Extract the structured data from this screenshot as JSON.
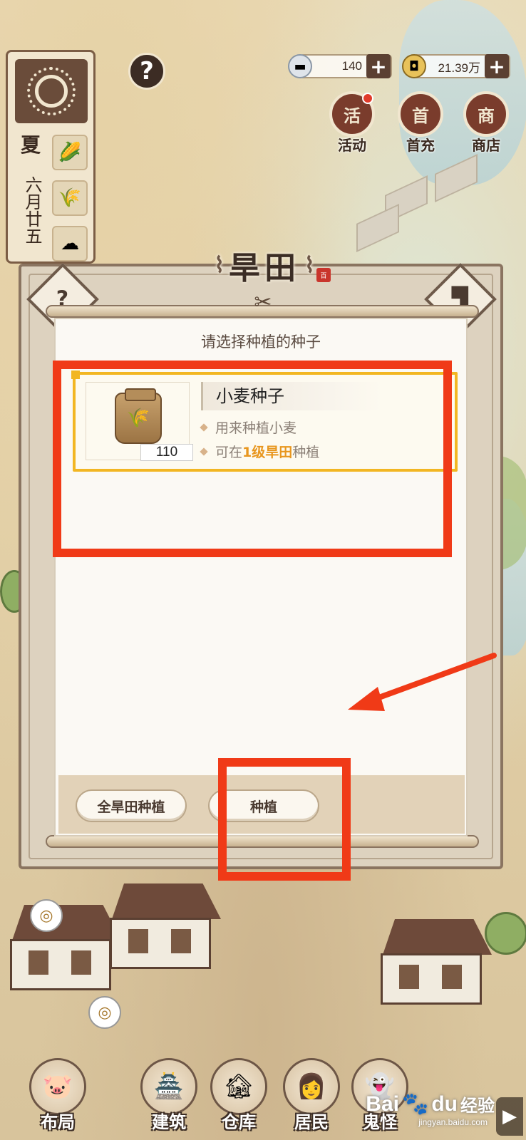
{
  "hud": {
    "season": "夏",
    "date": "六月廿五",
    "help_symbol": "?",
    "currency_silver": "140",
    "currency_coins": "21.39万",
    "plus_symbol": "+"
  },
  "top_buttons": [
    {
      "label": "活动",
      "icon_text": "活",
      "icon": "activity-icon",
      "has_notification": true
    },
    {
      "label": "首充",
      "icon_text": "首",
      "icon": "first-charge-icon",
      "has_notification": false
    },
    {
      "label": "商店",
      "icon_text": "商",
      "icon": "shop-icon",
      "has_notification": false
    }
  ],
  "dialog": {
    "title": "旱田",
    "stamp_text": "百",
    "help_symbol": "?",
    "heading": "请选择种植的种子",
    "seed": {
      "name": "小麦种子",
      "quantity": "110",
      "desc_1": "用来种植小麦",
      "desc_2_prefix": "可在",
      "desc_2_highlight": "1级旱田",
      "desc_2_suffix": "种植"
    },
    "buttons": {
      "plant_all": "全旱田种植",
      "plant": "种植"
    }
  },
  "bottom_nav": [
    {
      "label": "布局",
      "icon": "layout-icon",
      "glyph": "🐷"
    },
    {
      "label": "建筑",
      "icon": "building-icon",
      "glyph": "🏯"
    },
    {
      "label": "仓库",
      "icon": "warehouse-icon",
      "glyph": "🏚"
    },
    {
      "label": "居民",
      "icon": "residents-icon",
      "glyph": "👩"
    },
    {
      "label": "鬼怪",
      "icon": "ghost-icon",
      "glyph": "👻"
    }
  ],
  "watermark": {
    "text_1": "Bai",
    "text_2": "du",
    "text_cn": "经验",
    "sub": "jingyan.baidu.com"
  },
  "colors": {
    "annotation_red": "#f03a17",
    "highlight_orange": "#e8961e",
    "seed_border": "#f2b622"
  }
}
